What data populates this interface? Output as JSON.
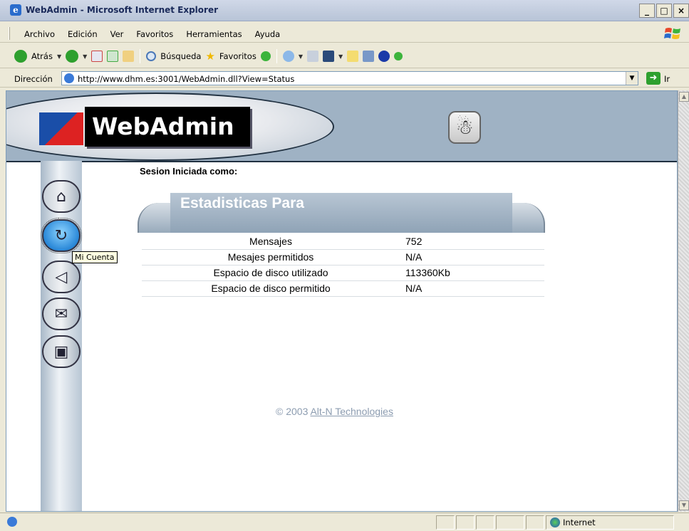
{
  "window": {
    "title": "WebAdmin - Microsoft Internet Explorer",
    "minimize": "_",
    "maximize": "□",
    "close": "×"
  },
  "menu": [
    "Archivo",
    "Edición",
    "Ver",
    "Favoritos",
    "Herramientas",
    "Ayuda"
  ],
  "toolbar": {
    "back_label": "Atrás",
    "search_label": "Búsqueda",
    "favorites_label": "Favoritos"
  },
  "address": {
    "label": "Dirección",
    "url": "http://www.dhm.es:3001/WebAdmin.dll?View=Status",
    "go_label": "Ir"
  },
  "page": {
    "logo_text": "WebAdmin",
    "session_label": "Sesion Iniciada como:",
    "stats_title": "Estadisticas Para",
    "tooltip": "Mi Cuenta",
    "stats": [
      {
        "label": "Mensajes",
        "value": "752"
      },
      {
        "label": "Mesajes permitidos",
        "value": "N/A"
      },
      {
        "label": "Espacio de disco utilizado",
        "value": "113360Kb"
      },
      {
        "label": "Espacio de disco permitido",
        "value": "N/A"
      }
    ],
    "footer_copyright": "© 2003 ",
    "footer_link": "Alt-N Technologies"
  },
  "nav_icons": [
    "home-icon",
    "account-icon",
    "filter-icon",
    "mail-routing-icon",
    "screen-icon"
  ],
  "status": {
    "zone": "Internet"
  },
  "colors": {
    "banner": "#9fb2c4",
    "stats_header": "#8fa3b6",
    "footer_text": "#8c9cb0"
  }
}
